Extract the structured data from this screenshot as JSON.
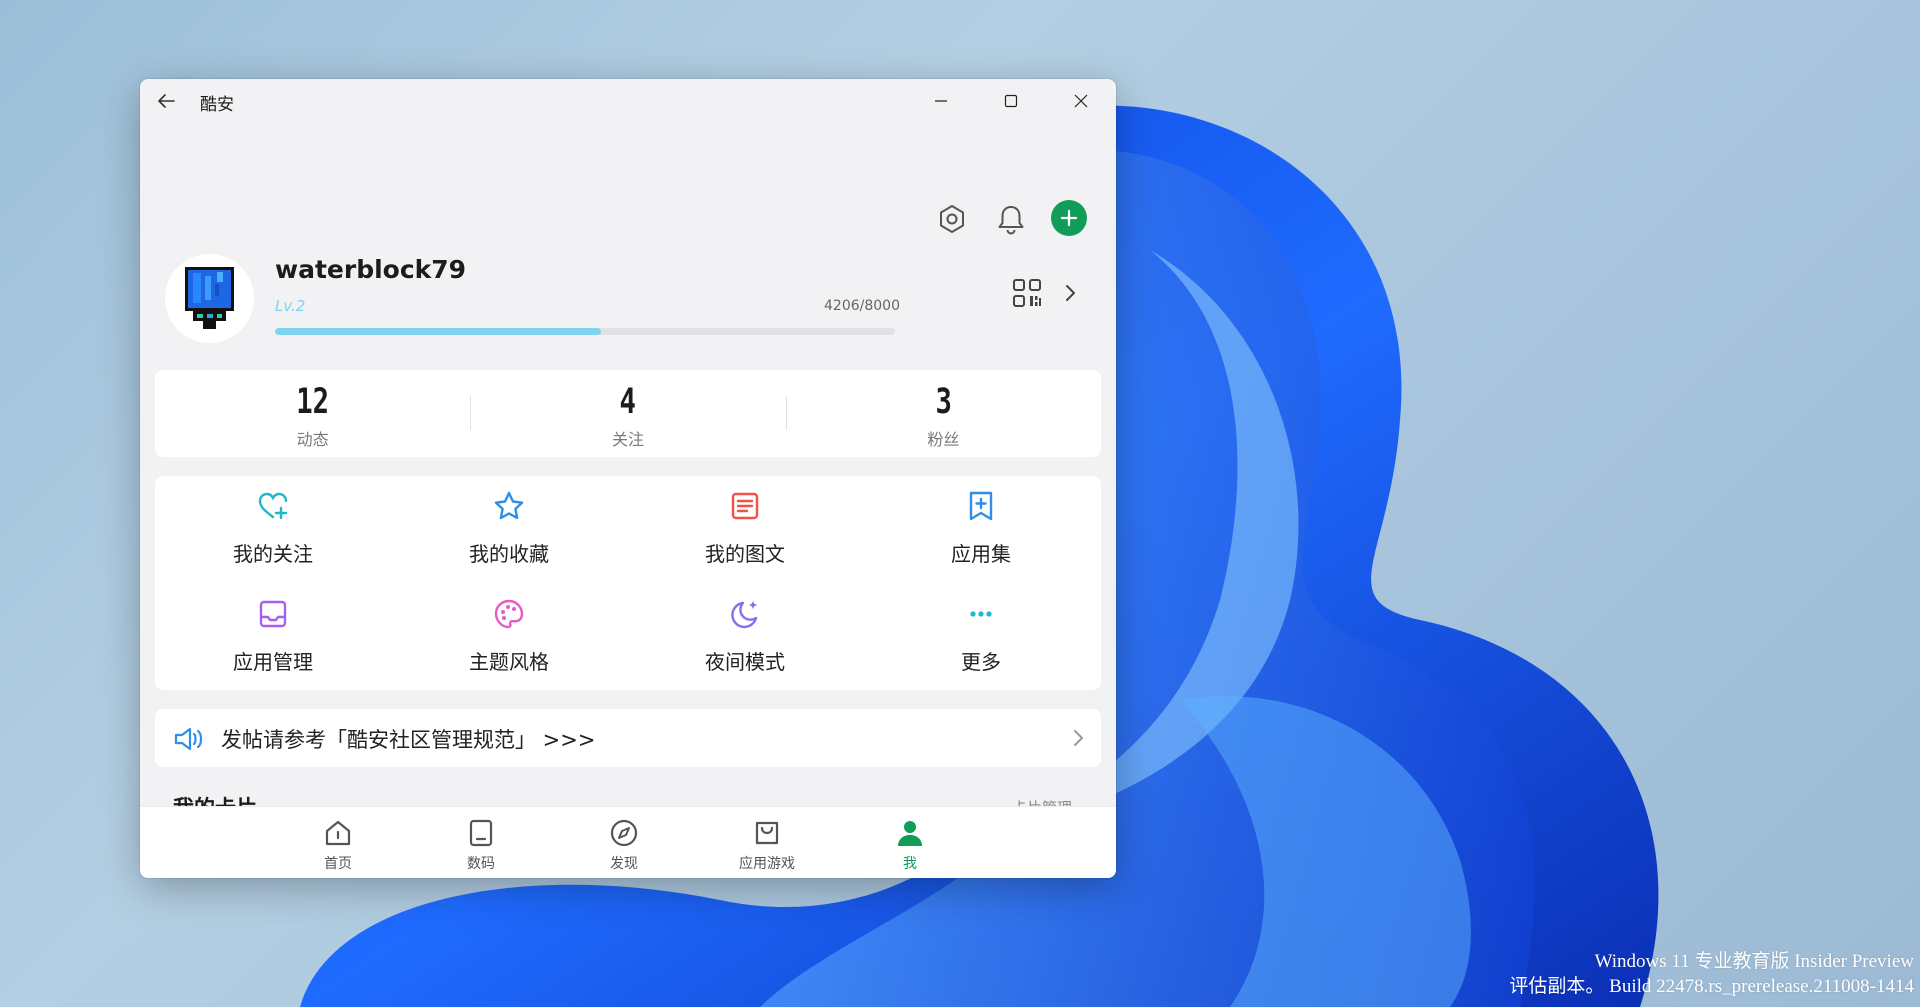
{
  "window": {
    "title": "酷安",
    "back_icon": "arrow-left-icon",
    "controls": [
      "minimize-icon",
      "maximize-icon",
      "close-icon"
    ]
  },
  "header_actions": {
    "settings_icon": "gear-icon",
    "notifications_icon": "bell-icon",
    "add_icon": "plus-icon",
    "add_color": "#109d58"
  },
  "profile": {
    "username": "waterblock79",
    "level": "Lv.2",
    "exp": "4206/8000",
    "exp_progress": 0.526,
    "exp_color": "#7fd3ee",
    "qr_icon": "qr-code-icon",
    "chevron_icon": "chevron-right-icon"
  },
  "stats": [
    {
      "value": "12",
      "label": "动态"
    },
    {
      "value": "4",
      "label": "关注"
    },
    {
      "value": "3",
      "label": "粉丝"
    }
  ],
  "menu": [
    {
      "label": "我的关注",
      "icon": "heart-plus-icon",
      "color": "#1fb8c9"
    },
    {
      "label": "我的收藏",
      "icon": "star-icon",
      "color": "#2f8ee8"
    },
    {
      "label": "我的图文",
      "icon": "article-icon",
      "color": "#f0524a"
    },
    {
      "label": "应用集",
      "icon": "bookmark-plus-icon",
      "color": "#2f8ee8"
    },
    {
      "label": "应用管理",
      "icon": "inbox-icon",
      "color": "#a561ee"
    },
    {
      "label": "主题风格",
      "icon": "palette-icon",
      "color": "#e95ac8"
    },
    {
      "label": "夜间模式",
      "icon": "moon-star-icon",
      "color": "#8a6cf0"
    },
    {
      "label": "更多",
      "icon": "more-dots-icon",
      "color": "#1fb8c9"
    }
  ],
  "notice": {
    "icon": "speaker-icon",
    "text": "发帖请参考「酷安社区管理规范」 >>>",
    "color": "#2f8ee8"
  },
  "cards_section": {
    "title": "我的卡片",
    "manage": "卡片管理"
  },
  "bottom_nav": [
    {
      "label": "首页",
      "icon": "home-icon",
      "active": false
    },
    {
      "label": "数码",
      "icon": "tablet-icon",
      "active": false
    },
    {
      "label": "发现",
      "icon": "compass-icon",
      "active": false
    },
    {
      "label": "应用游戏",
      "icon": "bag-icon",
      "active": false
    },
    {
      "label": "我",
      "icon": "user-icon",
      "active": true
    }
  ],
  "desktop": {
    "watermark_line1": "Windows 11 专业教育版 Insider Preview",
    "watermark_line2": "评估副本。 Build 22478.rs_prerelease.211008-1414"
  }
}
